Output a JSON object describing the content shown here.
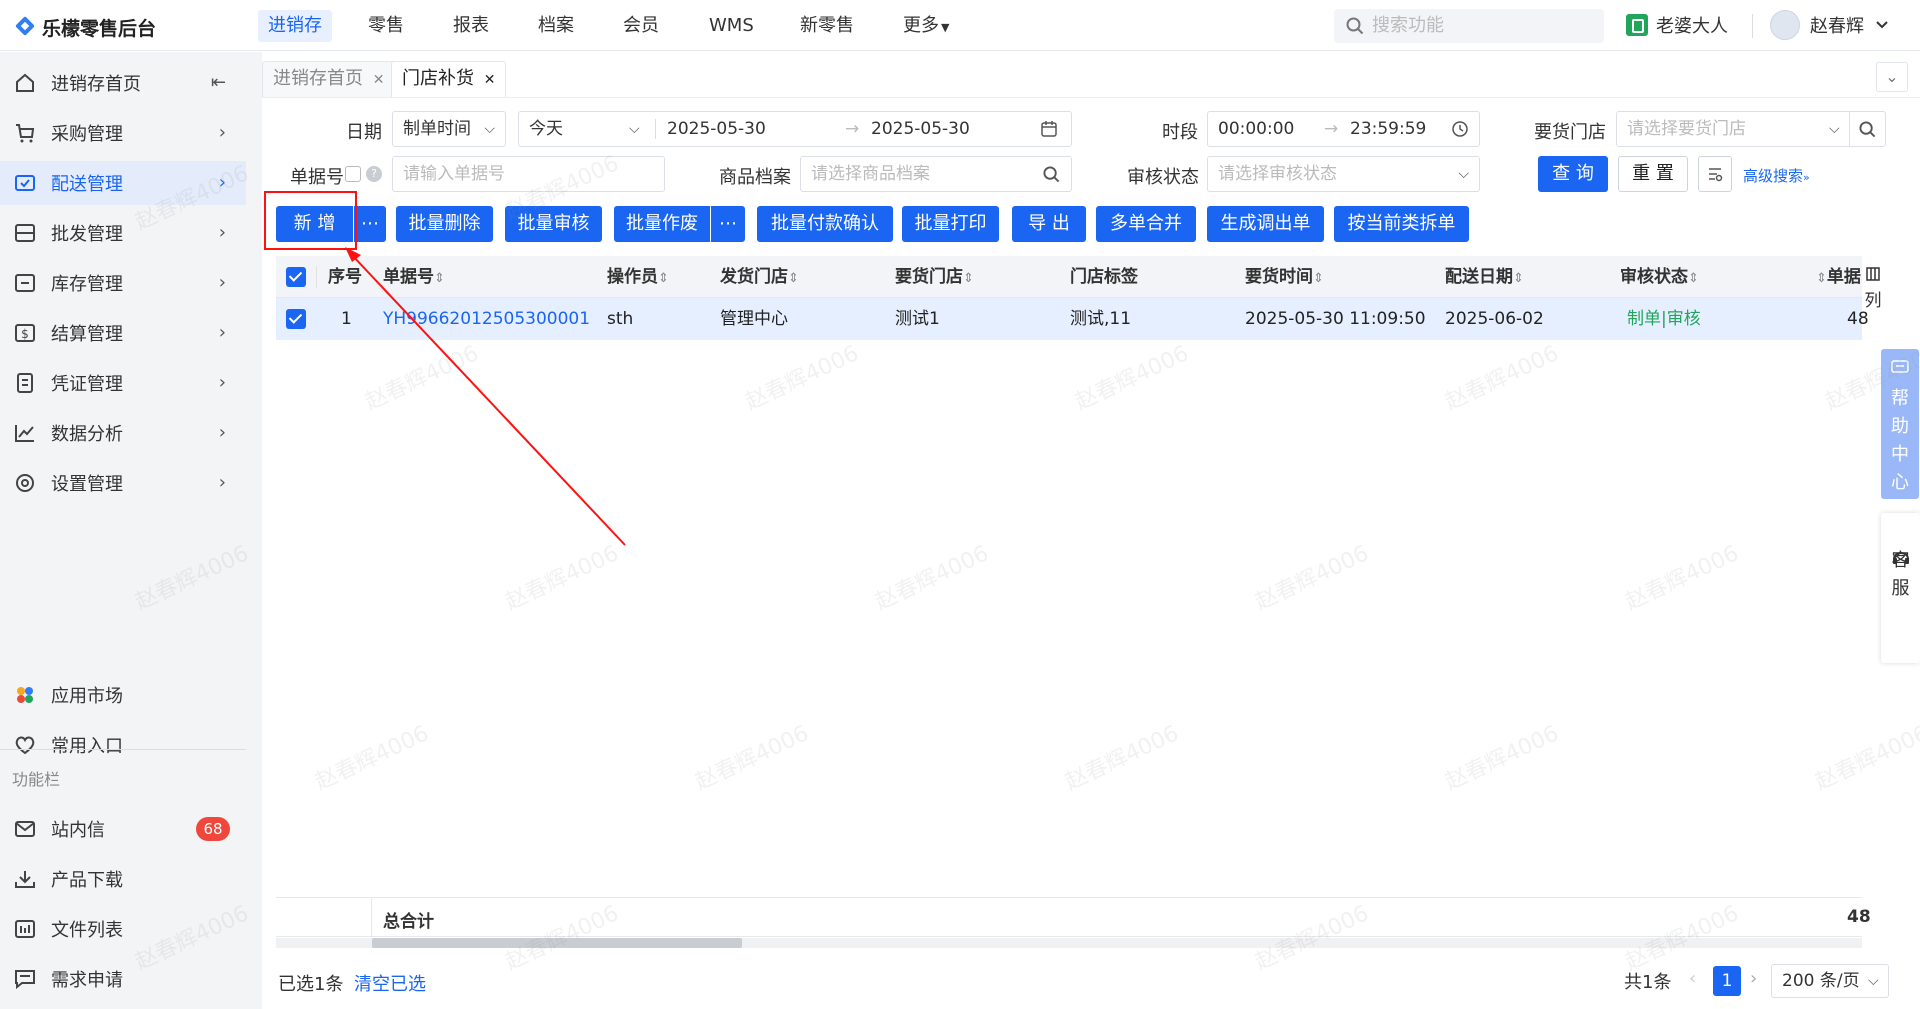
{
  "app": {
    "name": "乐檬零售后台"
  },
  "topnav": [
    "进销存",
    "零售",
    "报表",
    "档案",
    "会员",
    "WMS",
    "新零售",
    "更多"
  ],
  "search": {
    "placeholder": "搜索功能"
  },
  "user": {
    "shop": "老婆大人",
    "name": "赵春辉"
  },
  "sidebar": {
    "items": [
      {
        "label": "进销存首页",
        "icon": "home-icon"
      },
      {
        "label": "采购管理",
        "icon": "cart-icon"
      },
      {
        "label": "配送管理",
        "icon": "truck-icon"
      },
      {
        "label": "批发管理",
        "icon": "box-icon"
      },
      {
        "label": "库存管理",
        "icon": "inventory-icon"
      },
      {
        "label": "结算管理",
        "icon": "dollar-icon"
      },
      {
        "label": "凭证管理",
        "icon": "document-icon"
      },
      {
        "label": "数据分析",
        "icon": "chart-icon"
      },
      {
        "label": "设置管理",
        "icon": "settings-icon"
      }
    ],
    "bottom": [
      {
        "label": "应用市场",
        "icon": "app-market-icon"
      },
      {
        "label": "常用入口",
        "icon": "heart-icon"
      }
    ],
    "section_title": "功能栏",
    "tools": [
      {
        "label": "站内信",
        "icon": "mail-icon",
        "badge": "68"
      },
      {
        "label": "产品下载",
        "icon": "download-icon"
      },
      {
        "label": "文件列表",
        "icon": "file-list-icon"
      },
      {
        "label": "需求申请",
        "icon": "request-icon"
      }
    ]
  },
  "tabs": [
    {
      "label": "进销存首页"
    },
    {
      "label": "门店补货"
    }
  ],
  "filters": {
    "date_label": "日期",
    "date_type": "制单时间",
    "date_preset": "今天",
    "date_start": "2025-05-30",
    "date_end": "2025-05-30",
    "time_label": "时段",
    "time_start": "00:00:00",
    "time_end": "23:59:59",
    "store_label": "要货门店",
    "store_placeholder": "请选择要货门店",
    "docno_label": "单据号",
    "docno_placeholder": "请输入单据号",
    "goods_label": "商品档案",
    "goods_placeholder": "请选择商品档案",
    "audit_label": "审核状态",
    "audit_placeholder": "请选择审核状态",
    "query": "查 询",
    "reset": "重 置",
    "advanced": "高级搜索"
  },
  "actions": [
    "新 增",
    "批量删除",
    "批量审核",
    "批量作废",
    "批量付款确认",
    "批量打印",
    "导 出",
    "多单合并",
    "生成调出单",
    "按当前类拆单"
  ],
  "table": {
    "headers": [
      "序号",
      "单据号",
      "操作员",
      "发货门店",
      "要货门店",
      "门店标签",
      "要货时间",
      "配送日期",
      "审核状态",
      "单据"
    ],
    "rows": [
      {
        "index": "1",
        "doc_no": "YH99662012505300001",
        "operator": "sth",
        "ship_store": "管理中心",
        "req_store": "测试1",
        "store_tag": "测试,11",
        "req_time": "2025-05-30 11:09:50",
        "delivery_date": "2025-06-02",
        "status_make": "制单",
        "status_audit": "审核",
        "amount_partial": "48"
      }
    ],
    "total_label": "总合计",
    "total_partial": "48"
  },
  "columns_button": "列",
  "help_center": "帮助中心",
  "customer_service": "客服",
  "footer": {
    "selected": "已选1条",
    "clear": "清空已选",
    "total": "共1条",
    "current_page": "1",
    "page_size": "200 条/页"
  },
  "watermark": "赵春辉4006"
}
